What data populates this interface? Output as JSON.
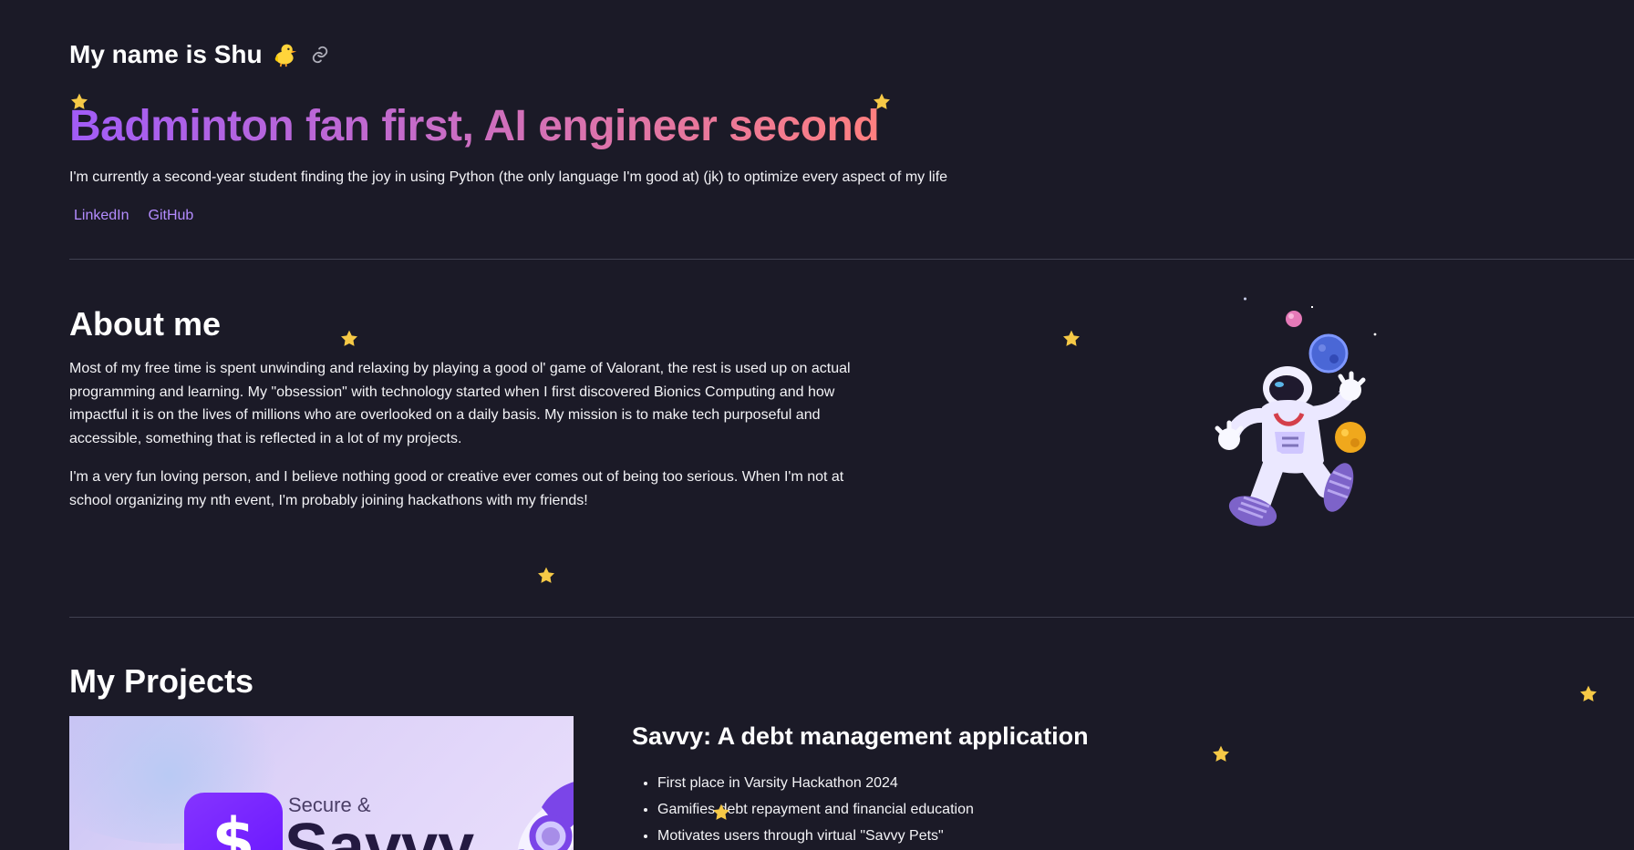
{
  "intro": {
    "name_title": "My name is Shu",
    "emoji": "🐤",
    "headline": "Badminton fan first, AI engineer second",
    "subtitle": "I'm currently a second-year student finding the joy in using Python (the only language I'm good at) (jk) to optimize every aspect of my life",
    "links": [
      {
        "label": "LinkedIn"
      },
      {
        "label": "GitHub"
      }
    ]
  },
  "about": {
    "heading": "About me",
    "paragraphs": [
      "Most of my free time is spent unwinding and relaxing by playing a good ol' game of Valorant, the rest is used up on actual programming and learning. My \"obsession\" with technology started when I first discovered Bionics Computing and how impactful it is on the lives of millions who are overlooked on a daily basis. My mission is to make tech purposeful and accessible, something that is reflected in a lot of my projects.",
      "I'm a very fun loving person, and I believe nothing good or creative ever comes out of being too serious. When I'm not at school organizing my nth event, I'm probably joining hackathons with my friends!"
    ]
  },
  "projects": {
    "heading": "My Projects",
    "items": [
      {
        "title": "Savvy: A debt management application",
        "image_tagline": "Secure &",
        "image_wordmark": "Savvy",
        "image_logo_glyph": "$",
        "bullets": [
          "First place in Varsity Hackathon 2024",
          "Gamifies debt repayment and financial education",
          "Motivates users through virtual \"Savvy Pets\""
        ]
      }
    ]
  },
  "colors": {
    "background": "#1b1a27",
    "heading_gradient_start": "#a15cf7",
    "heading_gradient_end": "#ff7f7f",
    "link": "#b48cff",
    "star": "#f6c946",
    "divider": "#414151"
  },
  "icons": {
    "anchor": "link-icon",
    "decorative_star": "star-icon",
    "illustration": "astronaut-illustration"
  }
}
